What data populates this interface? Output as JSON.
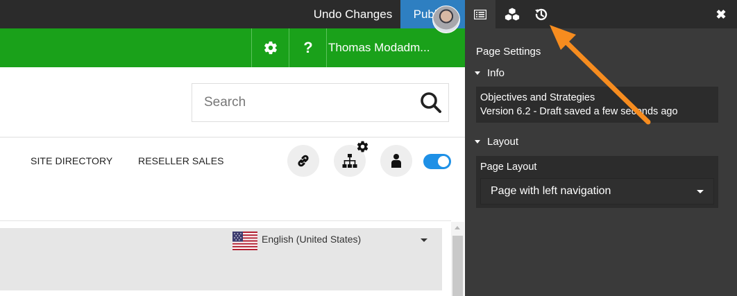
{
  "topbar": {
    "undo_label": "Undo Changes",
    "publish_label": "Publish"
  },
  "greenbar": {
    "settings_icon": "gear-icon",
    "help_label": "?",
    "user_name": "Thomas Modadm..."
  },
  "search": {
    "placeholder": "Search",
    "value": ""
  },
  "nav": {
    "links": [
      "SITE DIRECTORY",
      "RESELLER SALES"
    ],
    "icons": [
      "link-icon",
      "sitemap-icon",
      "gear-icon",
      "user-icon"
    ],
    "toggle_on": true
  },
  "language": {
    "selected": "English (United States)",
    "flag": "us-flag-icon"
  },
  "panel": {
    "tabs": [
      "page-settings-tab",
      "components-tab",
      "history-tab"
    ],
    "close_label": "✖",
    "title": "Page Settings",
    "info": {
      "heading": "Info",
      "page_name": "Objectives and Strategies",
      "version": "Version 6.2 - Draft saved a few seconds ago"
    },
    "layout": {
      "heading": "Layout",
      "field_label": "Page Layout",
      "selected": "Page with left navigation"
    }
  },
  "colors": {
    "topbar": "#2b2b2b",
    "green": "#1aa11a",
    "publish": "#2e7fc1",
    "panel": "#3a3a3a",
    "toggle": "#1e90e6",
    "annotation": "#f68c1f"
  }
}
